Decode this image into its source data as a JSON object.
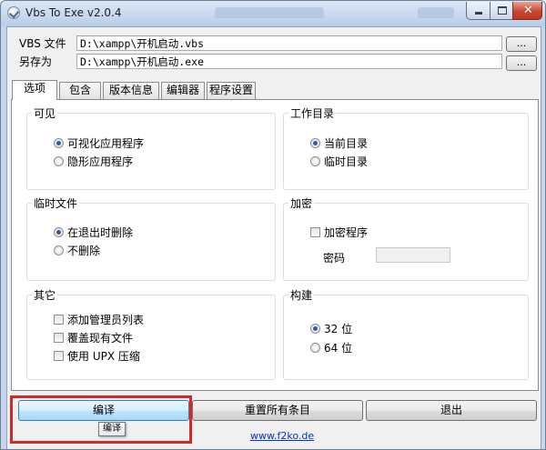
{
  "window": {
    "title": "Vbs To Exe v2.0.4"
  },
  "paths": {
    "vbs_label": "VBS 文件",
    "vbs_value": "D:\\xampp\\开机启动.vbs",
    "save_label": "另存为",
    "save_value": "D:\\xampp\\开机启动.exe",
    "browse_label": "..."
  },
  "tabs": [
    {
      "label": "选项",
      "active": true
    },
    {
      "label": "包含",
      "active": false
    },
    {
      "label": "版本信息",
      "active": false
    },
    {
      "label": "编辑器",
      "active": false
    },
    {
      "label": "程序设置",
      "active": false
    }
  ],
  "groups": {
    "visibility": {
      "title": "可见",
      "options": [
        {
          "label": "可视化应用程序",
          "selected": true
        },
        {
          "label": "隐形应用程序",
          "selected": false
        }
      ]
    },
    "workdir": {
      "title": "工作目录",
      "options": [
        {
          "label": "当前目录",
          "selected": true
        },
        {
          "label": "临时目录",
          "selected": false
        }
      ]
    },
    "tempfiles": {
      "title": "临时文件",
      "options": [
        {
          "label": "在退出时删除",
          "selected": true
        },
        {
          "label": "不删除",
          "selected": false
        }
      ]
    },
    "encryption": {
      "title": "加密",
      "encrypt_label": "加密程序",
      "encrypt_checked": false,
      "password_label": "密码",
      "password_value": ""
    },
    "other": {
      "title": "其它",
      "options": [
        {
          "label": "添加管理员列表",
          "checked": false
        },
        {
          "label": "覆盖现有文件",
          "checked": false
        },
        {
          "label": "使用 UPX 压缩",
          "checked": false
        }
      ]
    },
    "build": {
      "title": "构建",
      "options": [
        {
          "label": "32 位",
          "selected": true
        },
        {
          "label": "64 位",
          "selected": false
        }
      ]
    }
  },
  "buttons": {
    "compile": "编译",
    "reset": "重置所有条目",
    "exit": "退出"
  },
  "tooltip": "编译",
  "footer": {
    "link": "www.f2ko.de"
  },
  "colors": {
    "highlight": "#d62828",
    "link": "#0033cc",
    "radio_dot": "#2d5e9b"
  }
}
